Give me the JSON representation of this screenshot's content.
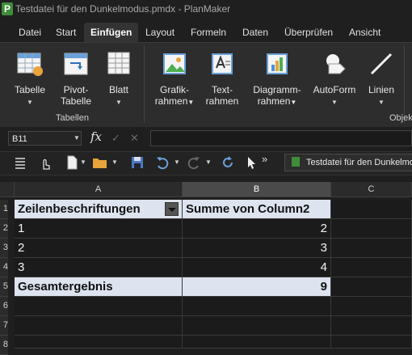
{
  "window": {
    "title": "Testdatei für den Dunkelmodus.pmdx - PlanMaker",
    "app_icon_letter": "P"
  },
  "menu": {
    "items": [
      "Datei",
      "Start",
      "Einfügen",
      "Layout",
      "Formeln",
      "Daten",
      "Überprüfen",
      "Ansicht"
    ],
    "active": "Einfügen"
  },
  "ribbon": {
    "buttons": {
      "tabelle": {
        "line1": "Tabelle",
        "line2": ""
      },
      "pivot": {
        "line1": "Pivot-",
        "line2": "Tabelle"
      },
      "blatt": {
        "line1": "Blatt",
        "line2": ""
      },
      "grafik": {
        "line1": "Grafik-",
        "line2": "rahmen"
      },
      "text": {
        "line1": "Text-",
        "line2": "rahmen"
      },
      "diagramm": {
        "line1": "Diagramm-",
        "line2": "rahmen"
      },
      "autoform": {
        "line1": "AutoForm",
        "line2": ""
      },
      "linien": {
        "line1": "Linien",
        "line2": ""
      }
    },
    "groups": {
      "tabellen": "Tabellen",
      "objekte": "Objek"
    },
    "dropdown_arrow": "▼"
  },
  "formula_bar": {
    "cell_ref": "B11",
    "fx": "fx",
    "confirm": "✓",
    "cancel": "✕",
    "content": ""
  },
  "toolbar": {
    "more": "»",
    "doc_tab": "Testdatei für den Dunkelmodus.pmdx"
  },
  "sheet": {
    "columns": [
      "A",
      "B",
      "C"
    ],
    "selected_column": "B",
    "rows": [
      "1",
      "2",
      "3",
      "4",
      "5",
      "6",
      "7",
      "8"
    ],
    "header_row": {
      "a": "Zeilenbeschriftungen",
      "b": "Summe von Column2"
    },
    "data_rows": [
      {
        "a": "1",
        "b": "2"
      },
      {
        "a": "2",
        "b": "3"
      },
      {
        "a": "3",
        "b": "4"
      }
    ],
    "total_row": {
      "a": "Gesamtergebnis",
      "b": "9"
    }
  },
  "colors": {
    "background": "#1f1f1f",
    "ribbon": "#2d2d2d",
    "pivot_header": "#dde4ef",
    "accent_blue": "#4a90d9",
    "accent_green": "#3f8d3a"
  }
}
